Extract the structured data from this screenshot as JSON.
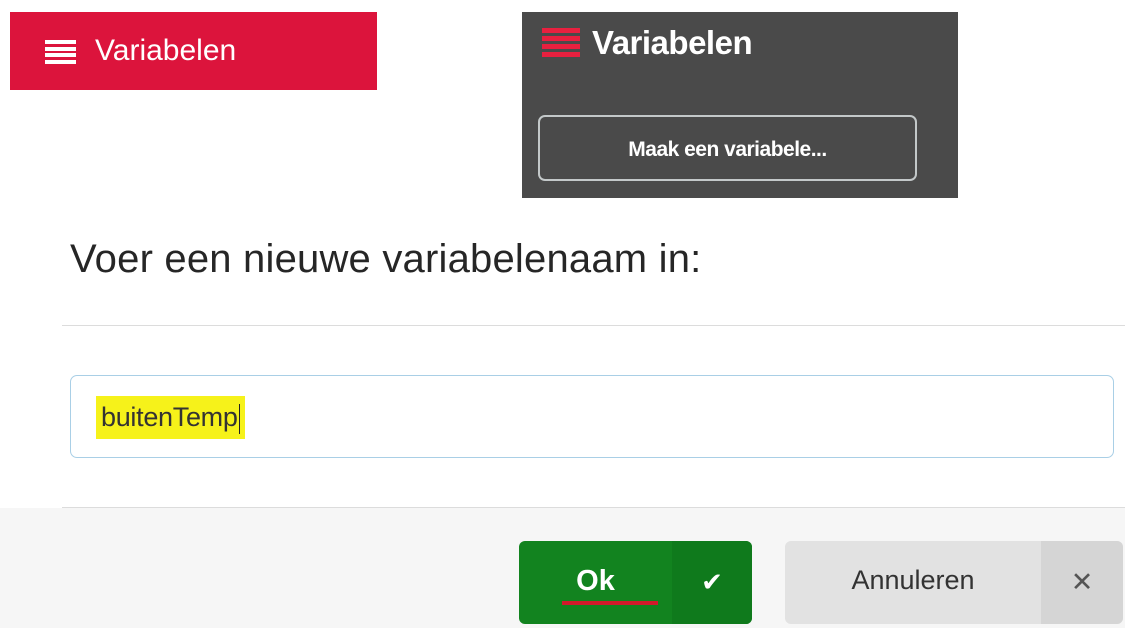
{
  "category_button": {
    "label": "Variabelen",
    "icon": "hamburger-icon",
    "color": "#dc143c"
  },
  "flyout": {
    "title": "Variabelen",
    "icon": "hamburger-icon",
    "icon_color": "#e8203f",
    "background": "#4a4a4a",
    "create_button_label": "Maak een variabele..."
  },
  "dialog": {
    "title": "Voer een nieuwe variabelenaam in:",
    "input_value": "buitenTemp",
    "ok_label": "Ok",
    "ok_icon": "checkmark-icon",
    "cancel_label": "Annuleren",
    "cancel_icon": "close-icon",
    "ok_color": "#12831f"
  }
}
